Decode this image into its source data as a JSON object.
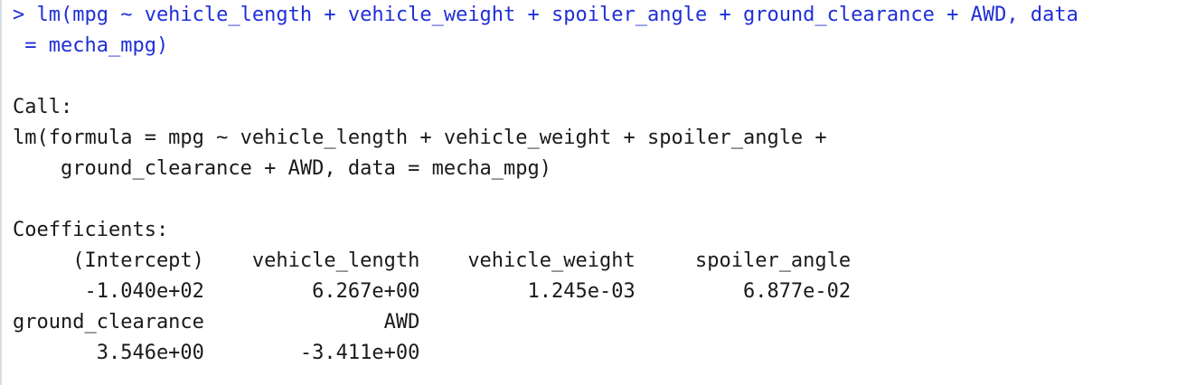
{
  "console": {
    "input": {
      "line1": "> lm(mpg ~ vehicle_length + vehicle_weight + spoiler_angle + ground_clearance + AWD, data",
      "line2": " = mecha_mpg)"
    },
    "output": {
      "call_header": "Call:",
      "call_line1": "lm(formula = mpg ~ vehicle_length + vehicle_weight + spoiler_angle +",
      "call_line2": "    ground_clearance + AWD, data = mecha_mpg)",
      "coef_header": "Coefficients:",
      "coef_names_row1": "     (Intercept)    vehicle_length    vehicle_weight     spoiler_angle",
      "coef_values_row1": "      -1.040e+02         6.267e+00         1.245e-03         6.877e-02",
      "coef_names_row2": "ground_clearance               AWD",
      "coef_values_row2": "       3.546e+00        -3.411e+00"
    },
    "colors": {
      "command": "#1f2fd6",
      "output": "#1a1a1a",
      "background": "#ffffff"
    }
  }
}
